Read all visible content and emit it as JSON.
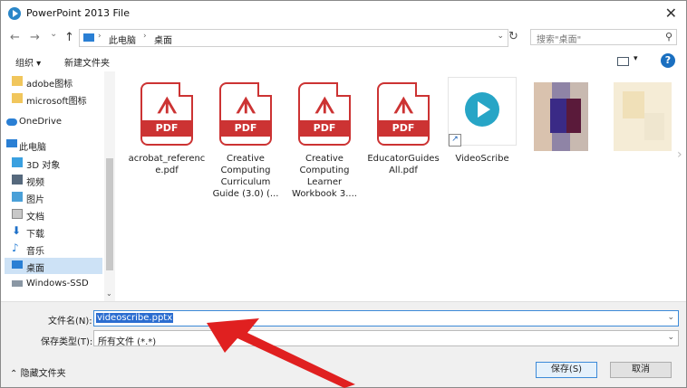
{
  "window": {
    "title": "PowerPoint 2013 File",
    "close_glyph": "✕"
  },
  "nav": {
    "back": "←",
    "forward": "→",
    "recent": "⌄",
    "up": "↑",
    "breadcrumb": [
      "此电脑",
      "桌面"
    ],
    "search_placeholder": "搜索\"桌面\""
  },
  "toolbar": {
    "organize": "组织 ▾",
    "new_folder": "新建文件夹",
    "help": "?"
  },
  "sidebar": {
    "items": [
      {
        "label": "adobe图标",
        "icon": "folder-icon"
      },
      {
        "label": "microsoft图标",
        "icon": "folder-icon"
      },
      {
        "label": "OneDrive",
        "icon": "cloud-icon"
      },
      {
        "label": "此电脑",
        "icon": "computer-icon"
      },
      {
        "label": "3D 对象",
        "icon": "cube-icon"
      },
      {
        "label": "视频",
        "icon": "video-icon"
      },
      {
        "label": "图片",
        "icon": "picture-icon"
      },
      {
        "label": "文档",
        "icon": "document-icon"
      },
      {
        "label": "下载",
        "icon": "download-icon"
      },
      {
        "label": "音乐",
        "icon": "music-icon"
      },
      {
        "label": "桌面",
        "icon": "desktop-icon",
        "selected": true
      },
      {
        "label": "Windows-SSD",
        "icon": "drive-icon"
      }
    ]
  },
  "files": [
    {
      "name": "acrobat_reference.pdf",
      "type": "pdf",
      "thumb_label": "PDF"
    },
    {
      "name": "Creative Computing Curriculum Guide (3.0) (...",
      "type": "pdf",
      "thumb_label": "PDF"
    },
    {
      "name": "Creative Computing Learner Workbook 3....",
      "type": "pdf",
      "thumb_label": "PDF"
    },
    {
      "name": "EducatorGuidesAll.pdf",
      "type": "pdf",
      "thumb_label": "PDF"
    },
    {
      "name": "VideoScribe",
      "type": "shortcut"
    }
  ],
  "form": {
    "filename_label": "文件名(N):",
    "filename_value": "videoscribe.pptx",
    "filetype_label": "保存类型(T):",
    "filetype_value": "所有文件 (*.*)"
  },
  "buttons": {
    "hide_folders": "隐藏文件夹",
    "save": "保存(S)",
    "cancel": "取消"
  },
  "colors": {
    "accent": "#2b6dd0",
    "pdf_red": "#cc3333",
    "videoscribe": "#27a5c6",
    "arrow": "#e02020"
  }
}
